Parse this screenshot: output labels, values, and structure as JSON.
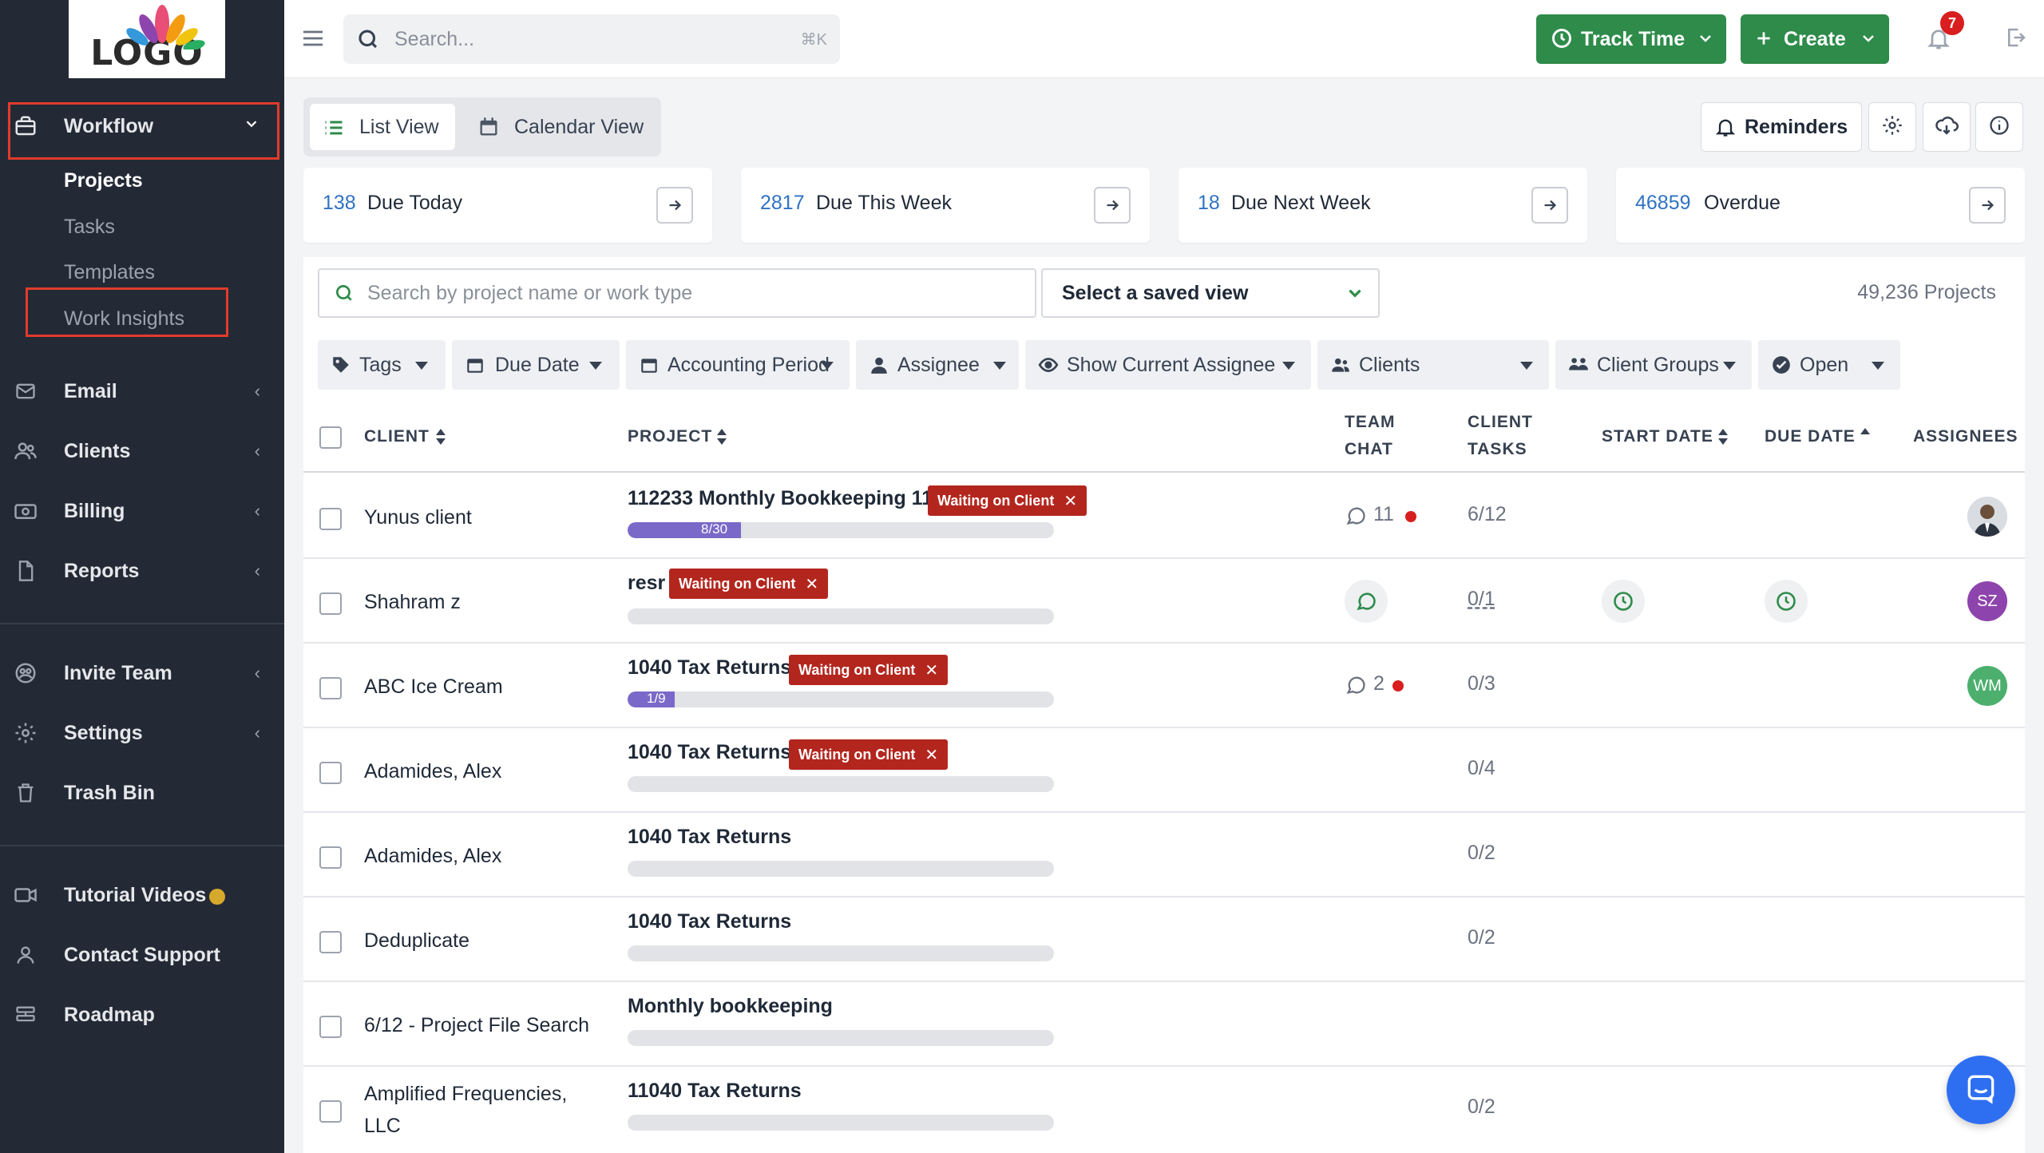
{
  "logo": {
    "text": "LOGO"
  },
  "sidebar": {
    "workflow_label": "Workflow",
    "sub_items": [
      {
        "label": "Projects",
        "active": true
      },
      {
        "label": "Tasks"
      },
      {
        "label": "Templates"
      },
      {
        "label": "Work Insights"
      }
    ],
    "items": [
      {
        "label": "Email",
        "icon": "envelope-icon"
      },
      {
        "label": "Clients",
        "icon": "users-icon"
      },
      {
        "label": "Billing",
        "icon": "billing-icon"
      },
      {
        "label": "Reports",
        "icon": "document-icon"
      },
      {
        "label": "Invite Team",
        "icon": "team-icon"
      },
      {
        "label": "Settings",
        "icon": "gear-icon"
      },
      {
        "label": "Trash Bin",
        "icon": "trash-icon"
      },
      {
        "label": "Tutorial Videos",
        "icon": "video-icon"
      },
      {
        "label": "Contact Support",
        "icon": "person-icon"
      },
      {
        "label": "Roadmap",
        "icon": "roadmap-icon"
      }
    ],
    "tutorial_dot_color": "#d6a92c"
  },
  "topbar": {
    "search_placeholder": "Search...",
    "search_shortcut": "⌘K",
    "track_time_label": "Track Time",
    "create_label": "Create",
    "notification_count": "7"
  },
  "views": {
    "list_label": "List View",
    "calendar_label": "Calendar View",
    "reminders_label": "Reminders"
  },
  "summary_cards": [
    {
      "count": "138",
      "label": "Due Today"
    },
    {
      "count": "2817",
      "label": "Due This Week"
    },
    {
      "count": "18",
      "label": "Due Next Week"
    },
    {
      "count": "46859",
      "label": "Overdue"
    }
  ],
  "projects_panel": {
    "search_placeholder": "Search by project name or work type",
    "saved_view_label": "Select a saved view",
    "project_count": "49,236 Projects",
    "filters": [
      "Tags",
      "Due Date",
      "Accounting Period",
      "Assignee",
      "Show Current Assignee",
      "Clients",
      "Client Groups",
      "Open"
    ]
  },
  "table": {
    "headers": {
      "client": "CLIENT",
      "project": "PROJECT",
      "team_chat_1": "TEAM",
      "team_chat_2": "CHAT",
      "client_tasks_1": "CLIENT",
      "client_tasks_2": "TASKS",
      "start_date": "START DATE",
      "due_date": "DUE DATE",
      "assignees": "ASSIGNEES"
    },
    "status_tag": "Waiting on Client",
    "rows": [
      {
        "client": "Yunus client",
        "project": "112233 Monthly Bookkeeping 11",
        "progress_text": "8/30",
        "progress": 0.2667,
        "chat": "11",
        "tasks": "6/12"
      },
      {
        "client": "Shahram z",
        "project": "resr",
        "tasks": "0/1",
        "avatar": "SZ"
      },
      {
        "client": "ABC Ice Cream",
        "project": "1040 Tax Returns",
        "progress_text": "1/9",
        "progress": 0.1111,
        "chat": "2",
        "tasks": "0/3",
        "avatar": "WM"
      },
      {
        "client": "Adamides, Alex",
        "project": "1040 Tax Returns",
        "tasks": "0/4"
      },
      {
        "client": "Adamides, Alex",
        "project": "1040 Tax Returns",
        "tasks": "0/2"
      },
      {
        "client": "Deduplicate",
        "project": "1040 Tax Returns",
        "tasks": "0/2"
      },
      {
        "client": "6/12 - Project File Search",
        "project": "Monthly bookkeeping"
      },
      {
        "client_line1": "Amplified Frequencies,",
        "client_line2": "LLC",
        "project": "11040 Tax Returns",
        "tasks": "0/2"
      }
    ]
  },
  "colors": {
    "sidebar_bg": "#232a35",
    "accent_green": "#2e8b4a",
    "link_blue": "#2f72c4",
    "status_red": "#b3261e",
    "progress_purple": "#7b69c9",
    "avatar_sz": "#8e44ad",
    "avatar_wm": "#4caf6e"
  }
}
